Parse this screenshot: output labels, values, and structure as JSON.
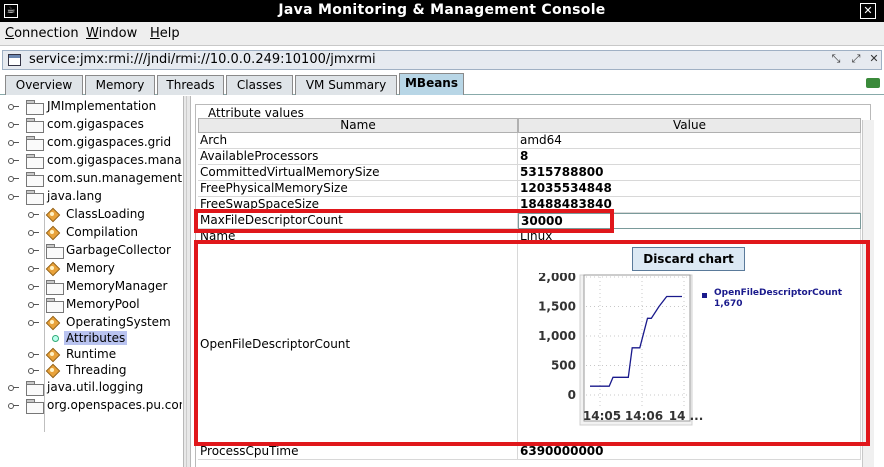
{
  "window": {
    "title": "Java Monitoring & Management Console",
    "icon": "java-icon",
    "close_icon": "close-icon"
  },
  "menu": {
    "items": [
      {
        "label": "Connection",
        "mnemonic": "C"
      },
      {
        "label": "Window",
        "mnemonic": "W"
      },
      {
        "label": "Help",
        "mnemonic": "H"
      }
    ]
  },
  "connection": {
    "url": "service:jmx:rmi:///jndi/rmi://10.0.0.249:10100/jmxrmi"
  },
  "tabs": [
    {
      "label": "Overview",
      "active": false
    },
    {
      "label": "Memory",
      "active": false
    },
    {
      "label": "Threads",
      "active": false
    },
    {
      "label": "Classes",
      "active": false
    },
    {
      "label": "VM Summary",
      "active": false
    },
    {
      "label": "MBeans",
      "active": true
    }
  ],
  "tree": {
    "items": [
      {
        "label": "JMImplementation",
        "type": "folder",
        "level": 0
      },
      {
        "label": "com.gigaspaces",
        "type": "folder",
        "level": 0
      },
      {
        "label": "com.gigaspaces.grid",
        "type": "folder",
        "level": 0
      },
      {
        "label": "com.gigaspaces.manag",
        "type": "folder",
        "level": 0
      },
      {
        "label": "com.sun.management",
        "type": "folder",
        "level": 0
      },
      {
        "label": "java.lang",
        "type": "folder",
        "level": 0
      },
      {
        "label": "ClassLoading",
        "type": "bean",
        "level": 1
      },
      {
        "label": "Compilation",
        "type": "bean",
        "level": 1
      },
      {
        "label": "GarbageCollector",
        "type": "folder",
        "level": 1
      },
      {
        "label": "Memory",
        "type": "bean",
        "level": 1
      },
      {
        "label": "MemoryManager",
        "type": "folder",
        "level": 1
      },
      {
        "label": "MemoryPool",
        "type": "folder",
        "level": 1
      },
      {
        "label": "OperatingSystem",
        "type": "bean",
        "level": 1
      },
      {
        "label": "Attributes",
        "type": "leaf",
        "level": 2,
        "selected": true
      },
      {
        "label": "Runtime",
        "type": "bean",
        "level": 1
      },
      {
        "label": "Threading",
        "type": "bean",
        "level": 1
      },
      {
        "label": "java.util.logging",
        "type": "folder",
        "level": 0
      },
      {
        "label": "org.openspaces.pu.con",
        "type": "folder",
        "level": 0
      }
    ]
  },
  "attributes": {
    "group_title": "Attribute values",
    "col_name": "Name",
    "col_value": "Value",
    "rows": [
      {
        "name": "Arch",
        "value": "amd64",
        "bold": false
      },
      {
        "name": "AvailableProcessors",
        "value": "8",
        "bold": true
      },
      {
        "name": "CommittedVirtualMemorySize",
        "value": "5315788800",
        "bold": true
      },
      {
        "name": "FreePhysicalMemorySize",
        "value": "12035534848",
        "bold": true
      },
      {
        "name": "FreeSwapSpaceSize",
        "value": "18488483840",
        "bold": true
      },
      {
        "name": "MaxFileDescriptorCount",
        "value": "30000",
        "bold": true
      },
      {
        "name": "Name",
        "value": "Linux",
        "bold": false
      }
    ],
    "chart_row_name": "OpenFileDescriptorCount",
    "last_row": {
      "name": "ProcessCpuTime",
      "value": "6390000000"
    }
  },
  "chart": {
    "discard_label": "Discard chart",
    "legend_name": "OpenFileDescriptorCount",
    "legend_value": "1,670",
    "x_tick_1": "14:05",
    "x_tick_2": "14:06",
    "x_tick_3": "14 ..."
  },
  "colors": {
    "highlight": "#e0171b",
    "series": "#1a1a8c",
    "active_tab": "#b8d6e6",
    "selection": "#b9c3f0"
  },
  "chart_data": {
    "type": "line",
    "title": "",
    "xlabel": "",
    "ylabel": "",
    "ylim": [
      0,
      2000
    ],
    "yticks": [
      0,
      500,
      1000,
      1500,
      2000
    ],
    "ytick_labels": [
      "0",
      "500",
      "1,000",
      "1,500",
      "2,000"
    ],
    "xtick_labels": [
      "14:05",
      "14:06",
      "14 ..."
    ],
    "series": [
      {
        "name": "OpenFileDescriptorCount",
        "x": [
          0.0,
          0.5,
          1.0,
          1.2,
          1.6,
          2.0,
          2.2,
          2.6,
          3.0,
          3.2,
          3.6,
          4.0,
          4.4,
          4.8
        ],
        "y": [
          150,
          150,
          150,
          300,
          300,
          300,
          800,
          800,
          1300,
          1300,
          1500,
          1670,
          1670,
          1670
        ]
      }
    ],
    "legend": "right"
  }
}
